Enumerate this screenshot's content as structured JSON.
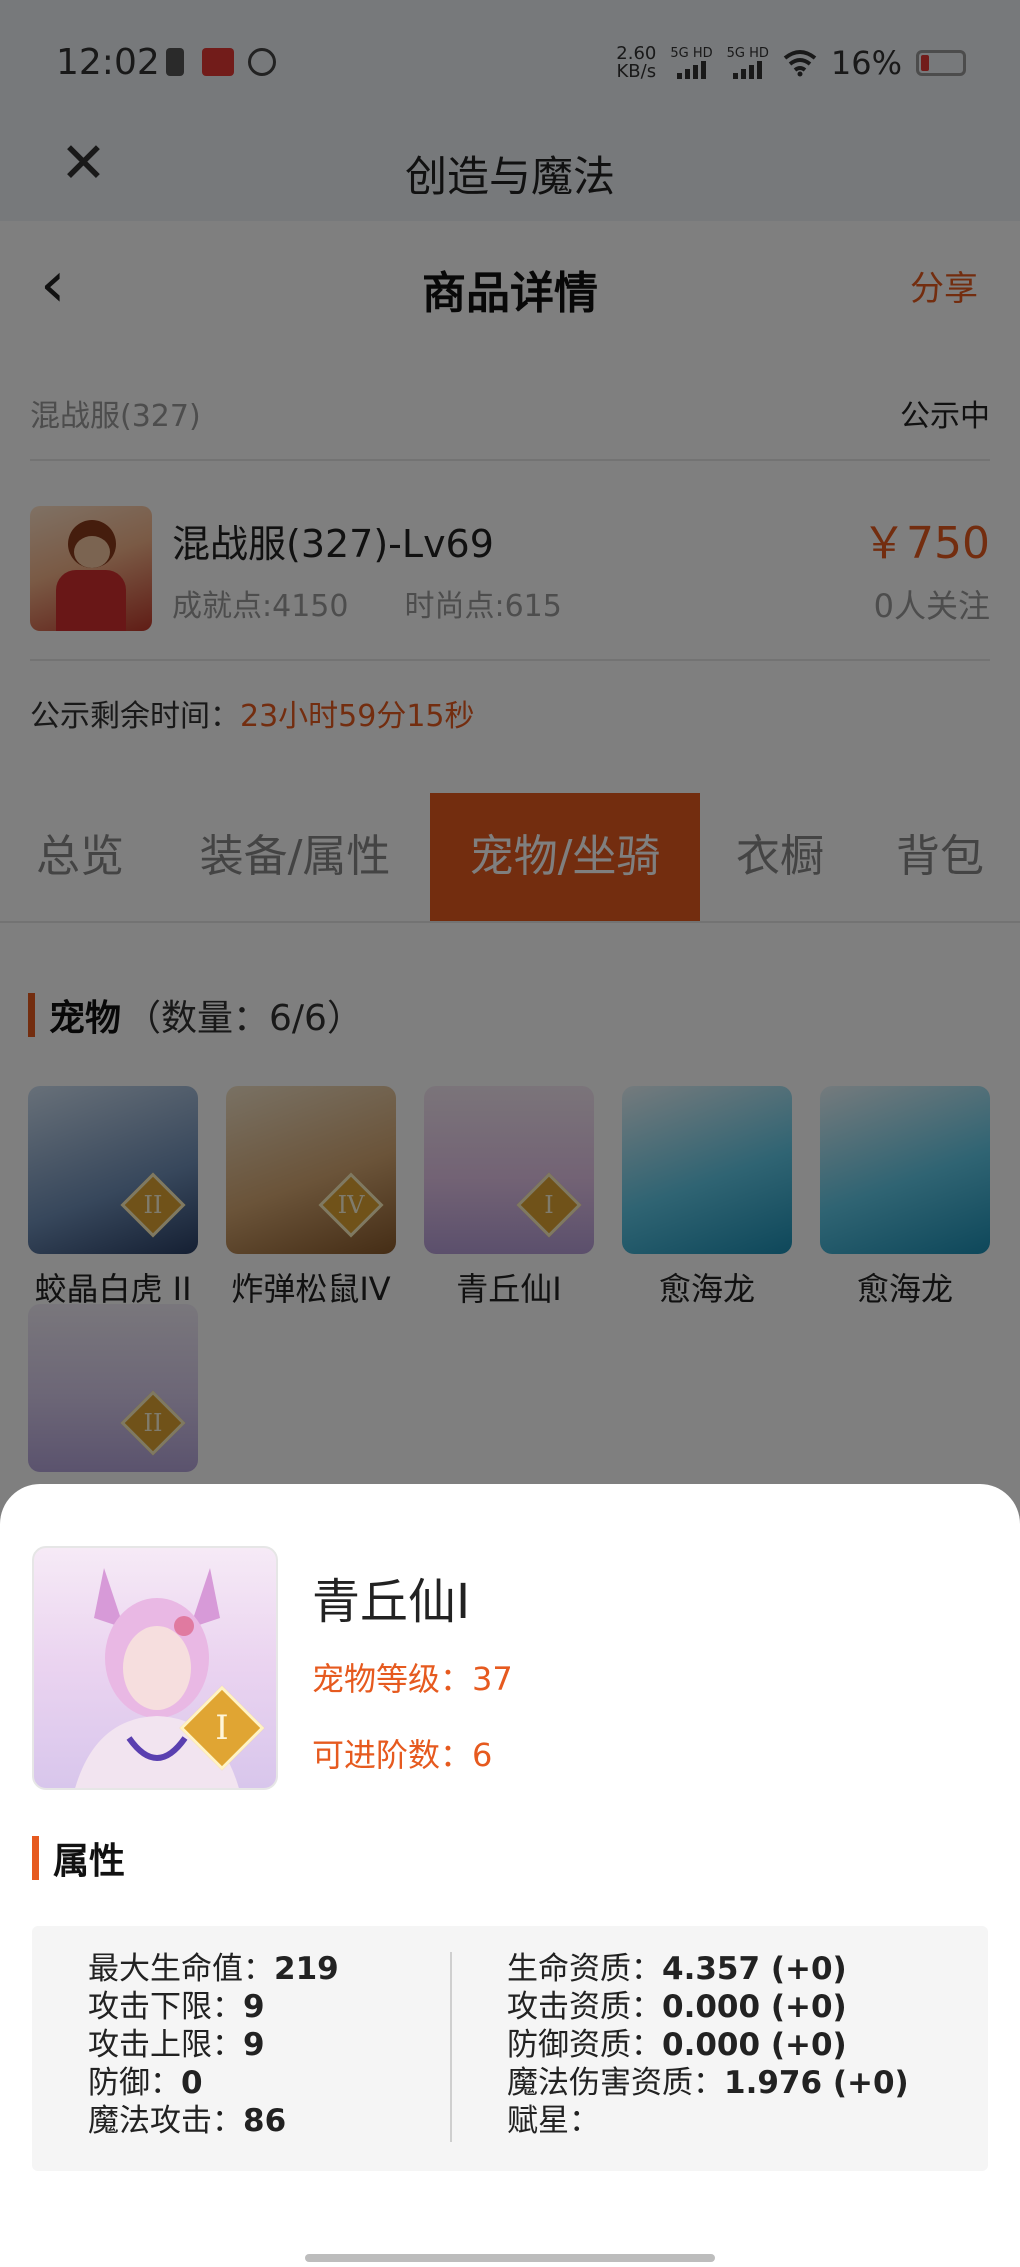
{
  "status_bar": {
    "time": "12:02",
    "net_speed_value": "2.60",
    "net_speed_unit": "KB/s",
    "signal1_label": "5G HD",
    "signal2_label": "5G HD",
    "battery_pct": "16%"
  },
  "app_header": {
    "title": "创造与魔法",
    "close_icon": "close-icon"
  },
  "nav": {
    "title": "商品详情",
    "share_label": "分享",
    "back_icon": "chevron-left-icon"
  },
  "server": {
    "name": "混战服(327)",
    "status": "公示中"
  },
  "product": {
    "name": "混战服(327)-Lv69",
    "achievement": "成就点:4150",
    "fashion": "时尚点:615",
    "price": "￥750",
    "followers": "0人关注"
  },
  "countdown": {
    "label": "公示剩余时间：",
    "value": "23小时59分15秒"
  },
  "tabs": [
    {
      "label": "总览"
    },
    {
      "label": "装备/属性"
    },
    {
      "label": "宠物/坐骑"
    },
    {
      "label": "衣橱"
    },
    {
      "label": "背包"
    }
  ],
  "active_tab": "宠物/坐骑",
  "pets_section": {
    "title": "宠物",
    "count": "（数量：6/6）",
    "pets": [
      {
        "name": "蛟晶白虎 II",
        "badge": "II"
      },
      {
        "name": "炸弹松鼠IV",
        "badge": "IV"
      },
      {
        "name": "青丘仙I",
        "badge": "I"
      },
      {
        "name": "愈海龙",
        "badge": ""
      },
      {
        "name": "愈海龙",
        "badge": ""
      },
      {
        "name": "",
        "badge": "II"
      }
    ]
  },
  "sheet": {
    "pet_name": "青丘仙I",
    "badge": "I",
    "level": "宠物等级：37",
    "advance": "可进阶数：6",
    "attr_title": "属性",
    "left_attrs": [
      {
        "label": "最大生命值：",
        "value": "219"
      },
      {
        "label": "攻击下限：",
        "value": "9"
      },
      {
        "label": "攻击上限：",
        "value": "9"
      },
      {
        "label": "防御：",
        "value": "0"
      },
      {
        "label": "魔法攻击：",
        "value": "86"
      }
    ],
    "right_attrs": [
      {
        "label": "生命资质：",
        "value": "4.357 (+0)"
      },
      {
        "label": "攻击资质：",
        "value": "0.000 (+0)"
      },
      {
        "label": "防御资质：",
        "value": "0.000 (+0)"
      },
      {
        "label": "魔法伤害资质：",
        "value": "1.976 (+0)"
      },
      {
        "label": "赋星：",
        "value": ""
      }
    ]
  },
  "colors": {
    "accent": "#e65a1f",
    "header_bg": "#eef2f7",
    "overlay": "rgba(0,0,0,0.5)"
  }
}
